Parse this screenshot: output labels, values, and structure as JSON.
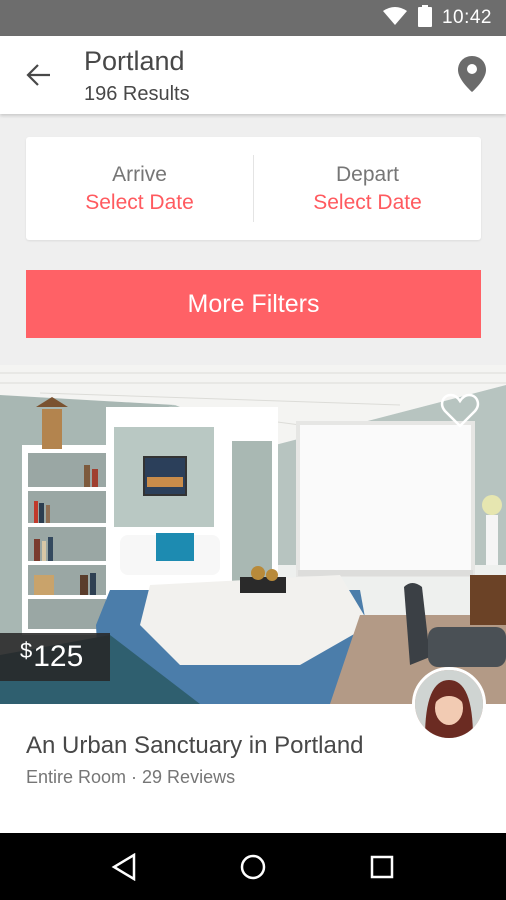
{
  "status_bar": {
    "time": "10:42"
  },
  "header": {
    "title": "Portland",
    "subtitle": "196 Results"
  },
  "dates": {
    "arrive_label": "Arrive",
    "arrive_value": "Select Date",
    "depart_label": "Depart",
    "depart_value": "Select Date"
  },
  "filters_button": "More Filters",
  "listing": {
    "currency": "$",
    "price": "125",
    "title": "An Urban Sanctuary in Portland",
    "meta": "Entire Room · 29 Reviews"
  },
  "colors": {
    "accent": "#ff5a5f",
    "button": "#ff6166",
    "status_bar": "#6d6d6d"
  },
  "icons": [
    "wifi-icon",
    "battery-icon",
    "back-arrow-icon",
    "map-pin-icon",
    "heart-icon",
    "nav-back-icon",
    "nav-home-icon",
    "nav-recents-icon"
  ]
}
